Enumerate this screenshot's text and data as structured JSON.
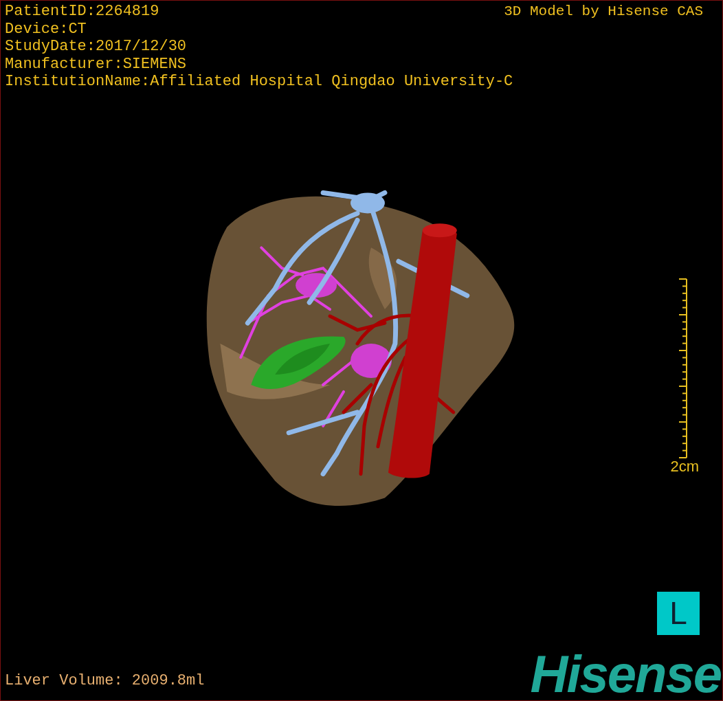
{
  "viewport": {
    "patient_info": [
      "PatientID:2264819",
      "Device:CT",
      "StudyDate:2017/12/30",
      "Manufacturer:SIEMENS",
      "InstitutionName:Affiliated Hospital Qingdao University-C"
    ],
    "title": "3D Model by Hisense CAS",
    "scale_label": "2cm",
    "orientation": "L",
    "measurement": "Liver Volume: 2009.8ml",
    "logo": "Hisense"
  }
}
